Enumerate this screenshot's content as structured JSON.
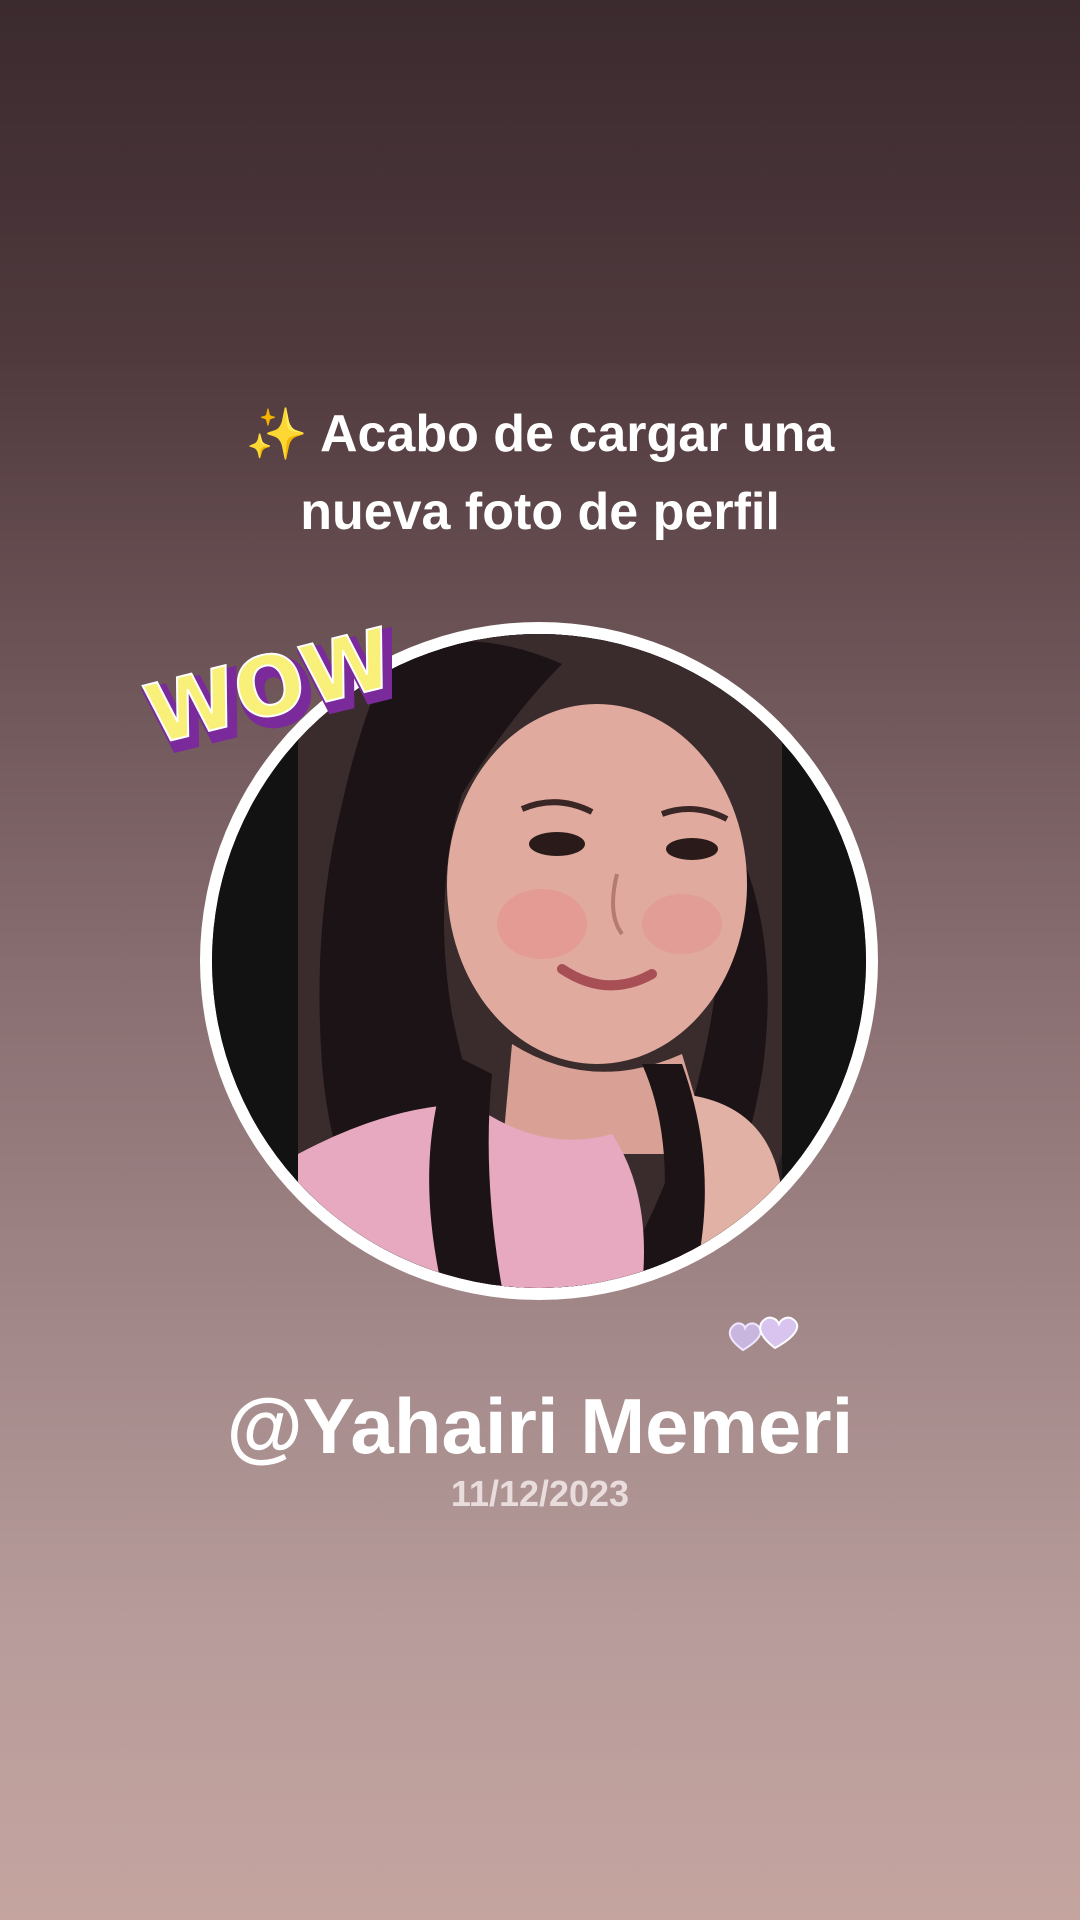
{
  "post": {
    "sparkle_icon": "✨",
    "headline_line1": "Acabo de cargar una",
    "headline_line2": "nueva foto de perfil",
    "sticker_text": "WOW!",
    "username": "@Yahairi Memeri",
    "date": "11/12/2023"
  },
  "colors": {
    "text": "#ffffff",
    "ring": "#ffffff",
    "sticker_yellow": "#f9f07a",
    "sticker_purple": "#7a2a9a"
  }
}
